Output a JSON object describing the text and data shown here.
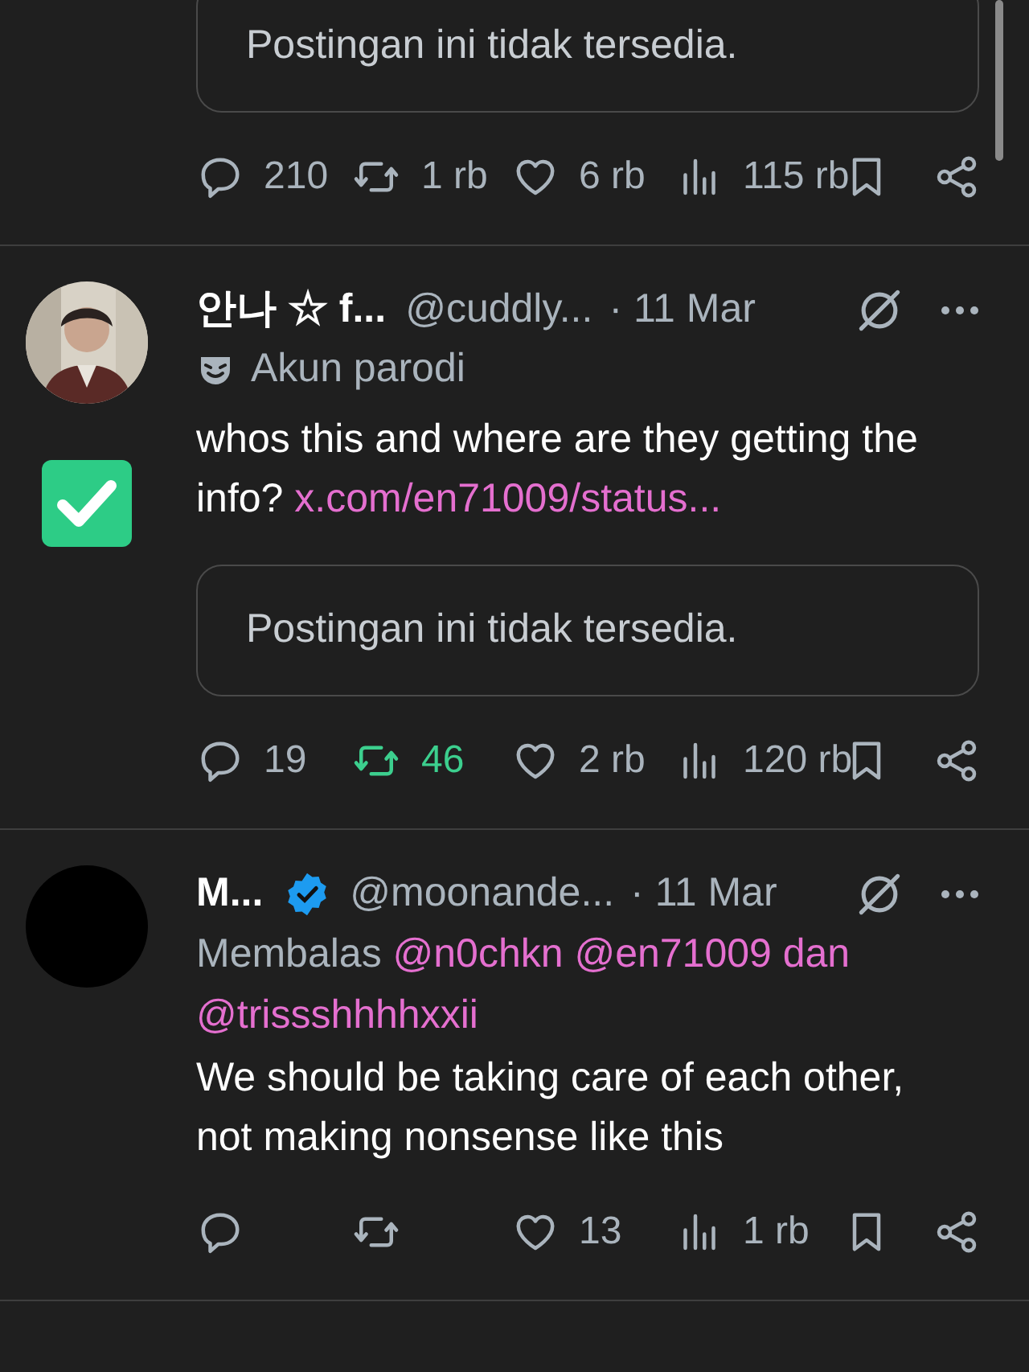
{
  "posts": [
    {
      "kind": "partial",
      "quote": "Postingan ini tidak tersedia.",
      "stats": {
        "replies": "210",
        "reposts": "1 rb",
        "likes": "6 rb",
        "views": "115 rb",
        "reposted": false
      }
    },
    {
      "kind": "full",
      "name": "안나 ☆ f...",
      "handle": "@cuddly...",
      "time": "· 11 Mar",
      "verified": false,
      "label": "Akun parodi",
      "text": "whos this and where are they getting the info? ",
      "link": "x.com/en71009/status...",
      "quote": "Postingan ini tidak tersedia.",
      "stats": {
        "replies": "19",
        "reposts": "46",
        "likes": "2 rb",
        "views": "120 rb",
        "reposted": true
      }
    },
    {
      "kind": "full",
      "avatar": {
        "kind": "plain"
      },
      "name": "M...",
      "handle": "@moonande...",
      "time": "· 11 Mar",
      "verified": true,
      "reply_label": "Membalas ",
      "reply_mentions": "@n0chkn @en71009 dan @trissshhhhxxii",
      "text": "We should be taking care of each other, not making nonsense like this",
      "stats": {
        "likes": "13",
        "views": "1 rb",
        "reposted": false
      }
    }
  ]
}
